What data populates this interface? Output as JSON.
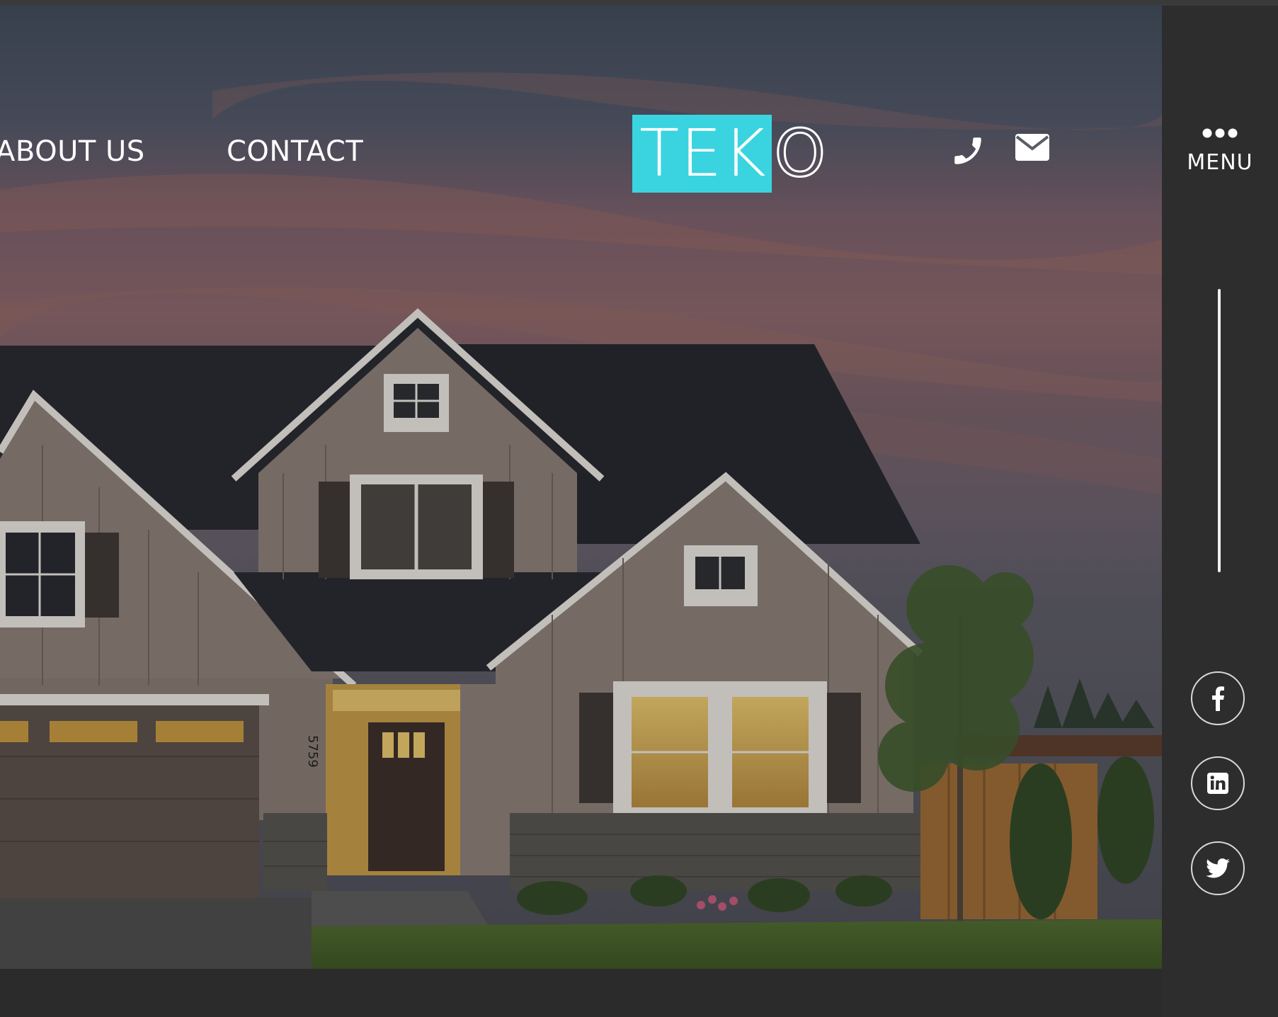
{
  "nav": {
    "about_label": "ABOUT US",
    "contact_label": "CONTACT"
  },
  "logo": {
    "boxed_text": "TEK",
    "outline_text": "O",
    "accent_color": "#3ad4e0"
  },
  "header_icons": {
    "phone": "phone-icon",
    "mail": "envelope-icon"
  },
  "sidebar": {
    "menu_label": "MENU",
    "menu_icon": "more-dots-icon",
    "social": [
      {
        "name": "facebook-icon"
      },
      {
        "name": "linkedin-icon"
      },
      {
        "name": "twitter-icon"
      }
    ]
  },
  "hero": {
    "house_number": "5759"
  }
}
